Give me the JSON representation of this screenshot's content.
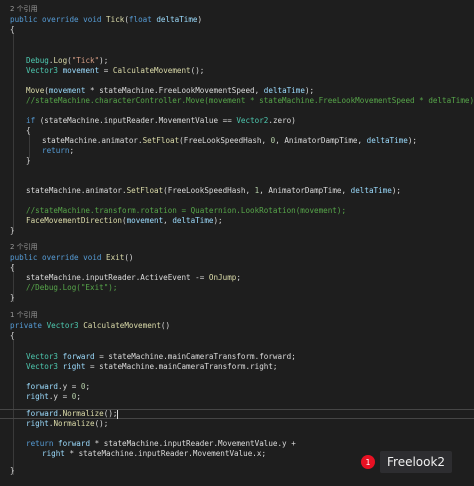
{
  "editor": {
    "references": [
      "2 个引用",
      "2 个引用",
      "1 个引用"
    ],
    "tick": {
      "sig": [
        "public",
        "override",
        "void",
        "Tick",
        "(",
        "float",
        "deltaTime",
        ")"
      ],
      "debug": [
        "Debug",
        ".",
        "Log",
        "(",
        "\"Tick\"",
        ");"
      ],
      "movement_decl": [
        "Vector3",
        "movement",
        "=",
        "CalculateMovement",
        "();"
      ],
      "move_call": [
        "Move",
        "(",
        "movement",
        "*",
        "stateMachine.",
        "FreeLookMovementSpeed",
        ",",
        "deltaTime",
        ");"
      ],
      "comment_move": "//stateMachine.characterController.Move(movement * stateMachine.FreeLookMovementSpeed * deltaTime);",
      "if_line": [
        "if",
        "(stateMachine.inputReader.MovementValue",
        "==",
        "Vector2",
        ".zero)"
      ],
      "setfloat_zero": [
        "stateMachine.animator.",
        "SetFloat",
        "(FreeLookSpeedHash,",
        "0",
        ", AnimatorDampTime,",
        "deltaTime",
        ");"
      ],
      "return_kw": "return",
      "setfloat_one": [
        "stateMachine.animator.",
        "SetFloat",
        "(FreeLookSpeedHash,",
        "1",
        ", AnimatorDampTime,",
        "deltaTime",
        ");"
      ],
      "comment_rotation": "//stateMachine.transform.rotation = Quaternion.LookRotation(movement);",
      "face_call": [
        "FaceMovementDirection",
        "(",
        "movement",
        ",",
        "deltaTime",
        ");"
      ]
    },
    "exit": {
      "sig": [
        "public",
        "override",
        "void",
        "Exit",
        "()"
      ],
      "unsubscribe": [
        "stateMachine.inputReader.ActiveEvent",
        "-=",
        "OnJump",
        ";"
      ],
      "comment_debug": "//Debug.Log(\"Exit\");"
    },
    "calc": {
      "sig": [
        "private",
        "Vector3",
        "CalculateMovement",
        "()"
      ],
      "forward_decl": [
        "Vector3",
        "forward",
        "= stateMachine.mainCameraTransform.forward;"
      ],
      "right_decl": [
        "Vector3",
        "right",
        "= stateMachine.mainCameraTransform.right;"
      ],
      "forward_y": [
        "forward",
        ".y =",
        "0",
        ";"
      ],
      "right_y": [
        "right",
        ".y =",
        "0",
        ";"
      ],
      "forward_norm": [
        "forward",
        ".",
        "Normalize",
        "();"
      ],
      "right_norm": [
        "right",
        ".",
        "Normalize",
        "();"
      ],
      "return_line": [
        "return",
        "forward",
        "* stateMachine.inputReader.MovementValue.y +"
      ],
      "return_cont": [
        "right",
        "* stateMachine.inputReader.MovementValue.x;"
      ]
    },
    "braces": {
      "open": "{",
      "close": "}"
    }
  },
  "notification": {
    "count": "1",
    "label": "Freelook2"
  }
}
